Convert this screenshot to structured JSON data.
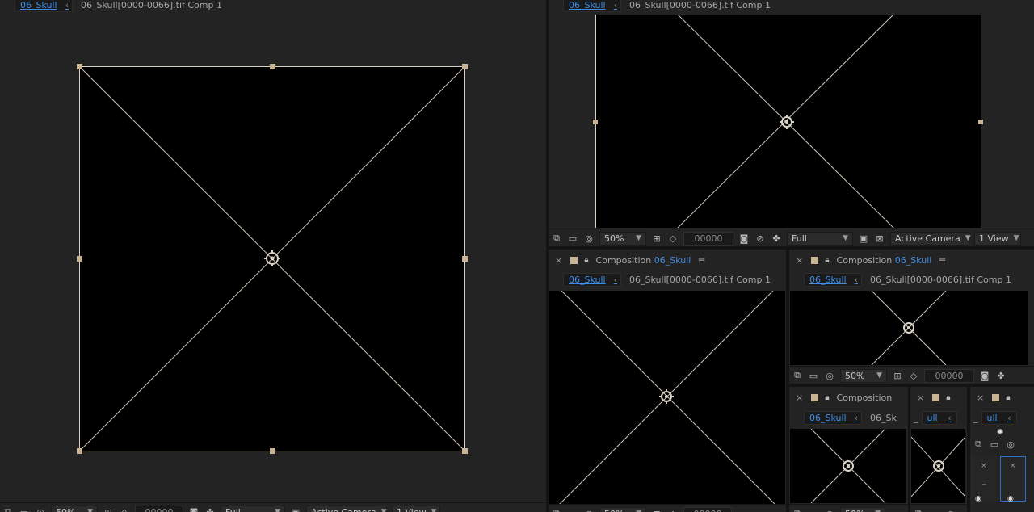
{
  "comp_name": "06_Skull",
  "layer_name": "06_Skull[0000-0066].tif Comp 1",
  "tab_label_prefix": "Composition",
  "tab_menu_glyph": "≡",
  "close_glyph": "×",
  "chevron_glyph": "‹",
  "zoom": "50%",
  "timecode": "00000",
  "resolution": "Full",
  "camera": "Active Camera",
  "views": "1 View",
  "small_tab_prefix": "Composition",
  "truncated_name": "ull",
  "truncated_layer": "06_Sk",
  "ellipsis": "…",
  "dash": "_",
  "colors": {
    "panel_bg": "#232323",
    "viewer_bg": "#000000",
    "link_blue": "#3f8ee6",
    "handle": "#c9b395",
    "label_swatch": "#c9b395"
  },
  "icons": [
    "snapshot-icon",
    "display-icon",
    "mask-icon",
    "region-icon",
    "transparency-icon",
    "camera-icon",
    "color-icon",
    "grid-icon",
    "lock-icon",
    "anchor-icon"
  ]
}
